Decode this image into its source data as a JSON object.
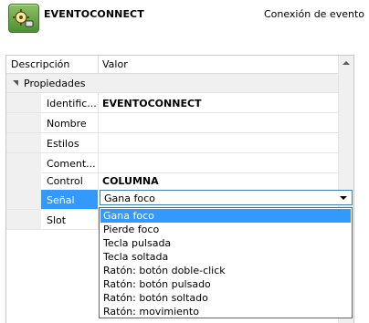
{
  "header": {
    "title": "EVENTOCONNECT",
    "subtitle": "Conexión de evento",
    "icon": "gear-plug-icon"
  },
  "grid": {
    "col_description": "Descripción",
    "col_value": "Valor",
    "group_label": "Propiedades",
    "rows": [
      {
        "name": "Identific...",
        "value": "EVENTOCONNECT"
      },
      {
        "name": "Nombre",
        "value": ""
      },
      {
        "name": "Estilos",
        "value": ""
      },
      {
        "name": "Coment...",
        "value": ""
      },
      {
        "name": "Control",
        "value": "COLUMNA"
      },
      {
        "name": "Señal",
        "value": ""
      },
      {
        "name": "Slot",
        "value": ""
      }
    ]
  },
  "combo": {
    "selected": "Gana foco"
  },
  "dropdown": {
    "options": [
      "Gana foco",
      "Pierde foco",
      "Tecla pulsada",
      "Tecla soltada",
      "Ratón: botón doble-click",
      "Ratón: botón pulsado",
      "Ratón: botón soltado",
      "Ratón: movimiento"
    ],
    "highlighted_index": 0
  },
  "colors": {
    "selection": "#3399ff",
    "icon_green": "#4e8f31"
  }
}
